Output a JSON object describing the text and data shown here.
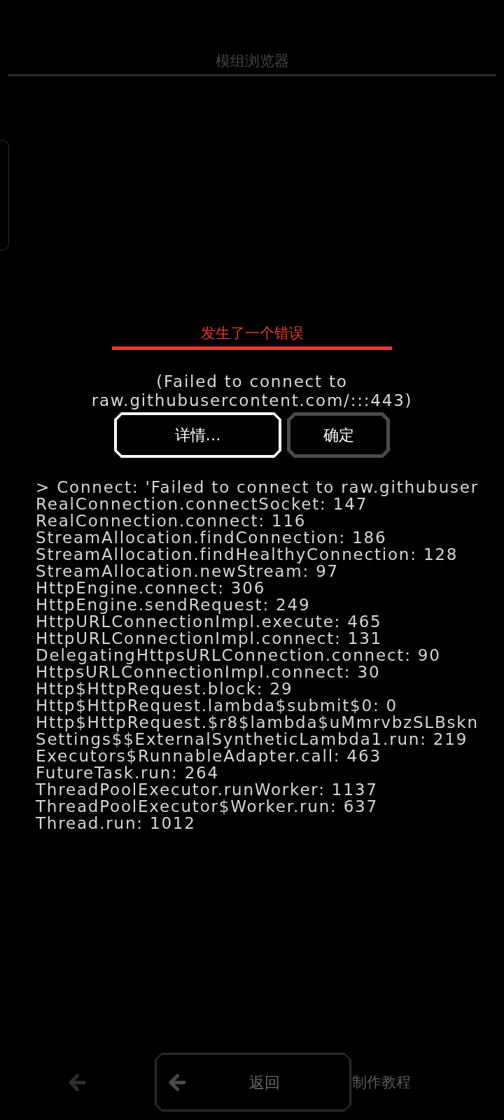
{
  "header": {
    "title": "模组浏览器"
  },
  "dialog": {
    "title": "发生了一个错误",
    "message": "(Failed to connect to raw.githubusercontent.com/:::443)",
    "buttons": [
      {
        "label": "详情…",
        "selected": true
      },
      {
        "label": "确定",
        "selected": false
      }
    ]
  },
  "log": {
    "lines": [
      "> Connect: 'Failed to connect to raw.githubuser",
      "RealConnection.connectSocket: 147",
      "RealConnection.connect: 116",
      "StreamAllocation.findConnection: 186",
      "StreamAllocation.findHealthyConnection: 128",
      "StreamAllocation.newStream: 97",
      "HttpEngine.connect: 306",
      "HttpEngine.sendRequest: 249",
      "HttpURLConnectionImpl.execute: 465",
      "HttpURLConnectionImpl.connect: 131",
      "DelegatingHttpsURLConnection.connect: 90",
      "HttpsURLConnectionImpl.connect: 30",
      "Http$HttpRequest.block: 29",
      "Http$HttpRequest.lambda$submit$0: 0",
      "Http$HttpRequest.$r8$lambda$uMmrvbzSLBskn",
      "Settings$$ExternalSyntheticLambda1.run: 219",
      "Executors$RunnableAdapter.call: 463",
      "FutureTask.run: 264",
      "ThreadPoolExecutor.runWorker: 1137",
      "ThreadPoolExecutor$Worker.run: 637",
      "Thread.run: 1012"
    ]
  },
  "footer": {
    "buttons": [
      {
        "kind": "icon"
      },
      {
        "kind": "back",
        "label": "返回"
      },
      {
        "kind": "text",
        "label": "制作教程"
      }
    ]
  }
}
